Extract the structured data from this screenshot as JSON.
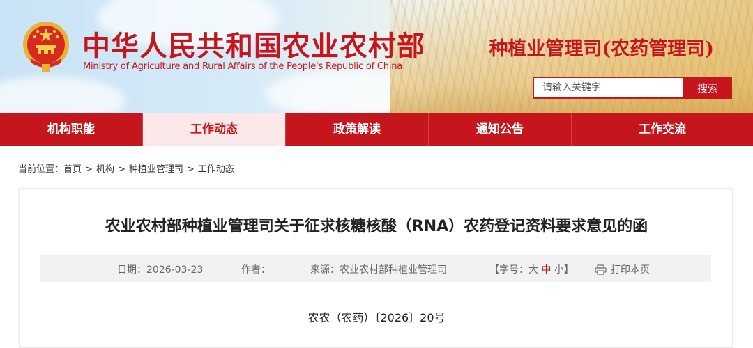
{
  "header": {
    "site_title": "中华人民共和国农业农村部",
    "site_subtitle": "Ministry of Agriculture and Rural Affairs of the People's Republic of China",
    "dept_title": "种植业管理司(农药管理司)",
    "emblem_icon": "national-emblem-icon",
    "search": {
      "placeholder": "请输入关键字",
      "button_label": "搜索"
    }
  },
  "nav": {
    "items": [
      {
        "label": "机构职能"
      },
      {
        "label": "工作动态"
      },
      {
        "label": "政策解读"
      },
      {
        "label": "通知公告"
      },
      {
        "label": "工作交流"
      }
    ],
    "active_index": 1
  },
  "breadcrumb": {
    "prefix": "当前位置：",
    "items": [
      "首页",
      "机构",
      "种植业管理司",
      "工作动态"
    ],
    "separator": ">"
  },
  "article": {
    "title": "农业农村部种植业管理司关于征求核糖核酸（RNA）农药登记资料要求意见的函",
    "meta": {
      "date_label": "日期：2026-03-23",
      "author_label": "作者：",
      "source_label": "来源：农业农村部种植业管理司",
      "fontsize_prefix": "【字号：",
      "fontsize_large": "大",
      "fontsize_medium": "中",
      "fontsize_small": "小",
      "fontsize_suffix": "】",
      "print_label": "打印本页",
      "print_icon": "printer-icon"
    },
    "doc_number": "农农（农药）〔2026〕20号"
  },
  "colors": {
    "brand_red": "#c4161c",
    "nav_active_bg": "#fbe9e9",
    "meta_bg": "#f2f2f2"
  }
}
